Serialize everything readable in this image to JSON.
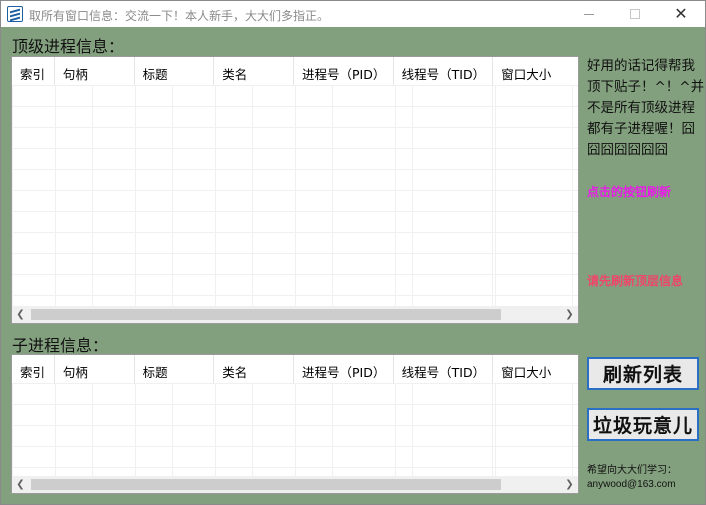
{
  "window": {
    "title": "取所有窗口信息：交流一下！本人新手，大大们多指正。",
    "close_glyph": "✕"
  },
  "top_section": {
    "label": "顶级进程信息：",
    "columns": [
      "索引",
      "句柄",
      "标题",
      "类名",
      "进程号（PID）",
      "线程号（TID）",
      "窗口大小"
    ]
  },
  "child_section": {
    "label": "子进程信息：",
    "columns": [
      "索引",
      "句柄",
      "标题",
      "类名",
      "进程号（PID）",
      "线程号（TID）",
      "窗口大小"
    ]
  },
  "scrollbar": {
    "left_arrow": "❮",
    "right_arrow": "❯"
  },
  "side": {
    "note": "好用的话记得帮我顶下贴子！^！^并不是所有顶级进程都有子进程喔！囧囧囧囧囧囧囧",
    "refresh_hint": "点击的按钮刷新",
    "warning_hint": "请先刷新顶层信息",
    "refresh_button": "刷新列表",
    "trash_button": "垃圾玩意儿",
    "footer_line1": "希望向大大们学习：",
    "footer_line2": "anywood@163.com"
  },
  "colors": {
    "background": "#83a07e",
    "accent_border": "#2a6fc4",
    "hint_magenta": "#e81ce8",
    "hint_red": "#f0456a"
  }
}
